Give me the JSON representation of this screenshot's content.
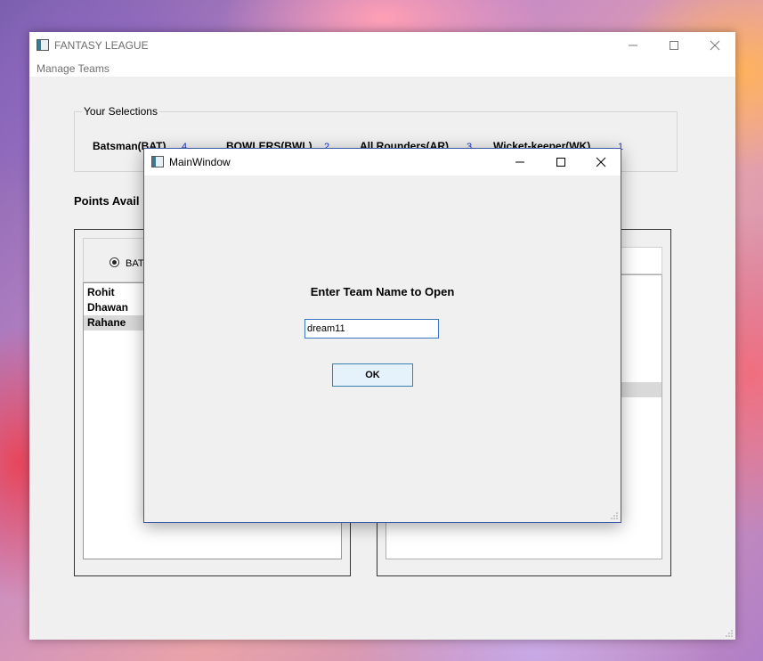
{
  "main_window": {
    "title": "FANTASY LEAGUE",
    "menu": [
      "Manage Teams"
    ],
    "selections": {
      "group_title": "Your Selections",
      "categories": [
        {
          "label": "Batsman(BAT)",
          "count": "4"
        },
        {
          "label": "BOWLERS(BWL)",
          "count": "2"
        },
        {
          "label": "All Rounders(AR)",
          "count": "3"
        },
        {
          "label": "Wicket-keeper(WK)",
          "count": "1"
        }
      ]
    },
    "points_label": "Points Avail",
    "left_panel": {
      "radio_label": "BAT",
      "players": [
        "Rohit",
        "Dhawan",
        "Rahane"
      ],
      "selected_player": "Rahane"
    }
  },
  "dialog": {
    "title": "MainWindow",
    "prompt": "Enter Team Name to Open",
    "team_name_value": "dream11",
    "ok_label": "OK"
  },
  "colors": {
    "accent_border": "#3b5ba8",
    "count_text": "#1a2fcf",
    "button_bg": "#e5f1fb"
  },
  "icons": {
    "minimize": "minimize-icon",
    "maximize": "maximize-icon",
    "close": "close-icon",
    "app": "app-window-icon"
  }
}
